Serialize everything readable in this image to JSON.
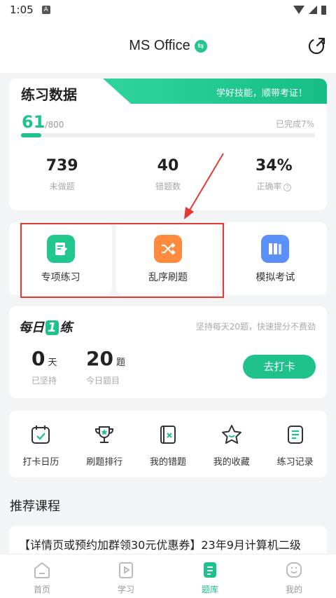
{
  "status": {
    "time": "1:05",
    "notif_icon": "A"
  },
  "header": {
    "title": "MS Office",
    "swap_glyph": "⇆"
  },
  "practice": {
    "title": "练习数据",
    "banner": "学好技能，顺带考证！",
    "done_count": "61",
    "total": "/800",
    "completed_text": "已完成7%",
    "progress_fraction": 0.07,
    "stats": [
      {
        "value": "739",
        "label": "未做题"
      },
      {
        "value": "40",
        "label": "错题数"
      },
      {
        "value": "34%",
        "label": "正确率"
      }
    ]
  },
  "modes": [
    {
      "label": "专项练习",
      "color": "#21c88e",
      "icon": "edit-note-icon"
    },
    {
      "label": "乱序刷题",
      "color": "#ff8a3d",
      "icon": "shuffle-icon"
    },
    {
      "label": "模拟考试",
      "color": "#5b8ff9",
      "icon": "books-icon"
    }
  ],
  "daily": {
    "logo_a": "每日",
    "logo_one": "1",
    "logo_b": "练",
    "tip": "坚持每天20题，快速提分不费劲",
    "days_value": "0",
    "days_unit": "天",
    "days_label": "已坚持",
    "today_value": "20",
    "today_unit": "题",
    "today_label": "今日题目",
    "button": "去打卡"
  },
  "tools": [
    {
      "label": "打卡日历",
      "icon": "calendar-check-icon"
    },
    {
      "label": "刷题排行",
      "icon": "trophy-icon"
    },
    {
      "label": "我的错题",
      "icon": "wrong-book-icon"
    },
    {
      "label": "我的收藏",
      "icon": "star-icon"
    },
    {
      "label": "练习记录",
      "icon": "record-icon"
    }
  ],
  "recommend": {
    "title": "推荐课程",
    "course_title": "【详情页或预约加群领30元优惠券】23年9月计算机二级"
  },
  "tabs": [
    {
      "label": "首页",
      "icon": "home-icon"
    },
    {
      "label": "学习",
      "icon": "play-icon"
    },
    {
      "label": "题库",
      "icon": "question-bank-icon"
    },
    {
      "label": "我的",
      "icon": "profile-icon"
    }
  ],
  "colors": {
    "accent": "#1fc28b",
    "highlight": "#e53935"
  }
}
